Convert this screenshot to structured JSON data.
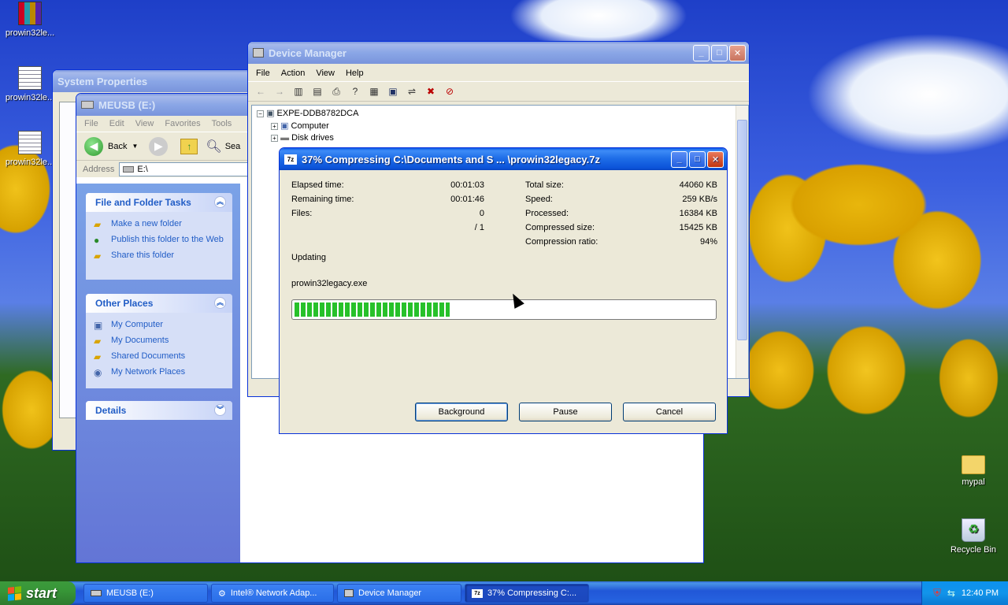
{
  "desktop_icons": [
    {
      "label": "prowin32le...",
      "icon": "winrar-archive-icon"
    },
    {
      "label": "prowin32le...",
      "icon": "text-file-icon"
    },
    {
      "label": "prowin32le...",
      "icon": "text-file-icon"
    },
    {
      "label": "mypal",
      "icon": "folder-icon"
    },
    {
      "label": "Recycle Bin",
      "icon": "recycle-bin-icon"
    }
  ],
  "system_properties": {
    "title": "System Properties"
  },
  "explorer": {
    "title": "MEUSB (E:)",
    "menu": [
      "File",
      "Edit",
      "View",
      "Favorites",
      "Tools"
    ],
    "back_label": "Back",
    "search_label": "Sea",
    "address_label": "Address",
    "address_value": "E:\\",
    "tasks": {
      "title": "File and Folder Tasks",
      "items": [
        "Make a new folder",
        "Publish this folder to the Web",
        "Share this folder"
      ]
    },
    "places": {
      "title": "Other Places",
      "items": [
        "My Computer",
        "My Documents",
        "Shared Documents",
        "My Network Places"
      ]
    },
    "details": {
      "title": "Details"
    }
  },
  "device_manager": {
    "title": "Device Manager",
    "menu": [
      "File",
      "Action",
      "View",
      "Help"
    ],
    "root": "EXPE-DDB8782DCA",
    "nodes": [
      "Computer",
      "Disk drives"
    ]
  },
  "compress_dialog": {
    "title": "37% Compressing C:\\Documents and S ... \\prowin32legacy.7z",
    "left": [
      {
        "label": "Elapsed time:",
        "value": "00:01:03"
      },
      {
        "label": "Remaining time:",
        "value": "00:01:46"
      },
      {
        "label": "Files:",
        "value": "0"
      },
      {
        "label": "",
        "value": "/ 1"
      }
    ],
    "right": [
      {
        "label": "Total size:",
        "value": "44060 KB"
      },
      {
        "label": "Speed:",
        "value": "259 KB/s"
      },
      {
        "label": "Processed:",
        "value": "16384 KB"
      },
      {
        "label": "Compressed size:",
        "value": "15425 KB"
      },
      {
        "label": "Compression ratio:",
        "value": "94%"
      }
    ],
    "status": "Updating",
    "current_file": "prowin32legacy.exe",
    "progress": 0.37,
    "buttons": {
      "background": "Background",
      "pause": "Pause",
      "cancel": "Cancel"
    }
  },
  "taskbar": {
    "start": "start",
    "tasks": [
      "MEUSB (E:)",
      "Intel® Network Adap...",
      "Device Manager",
      "37% Compressing C:..."
    ],
    "clock": "12:40 PM"
  }
}
